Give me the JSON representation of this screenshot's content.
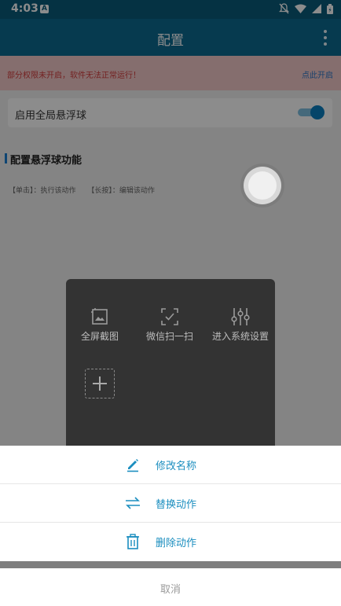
{
  "status": {
    "time": "4:03",
    "app_badge": "A"
  },
  "appbar": {
    "title": "配置"
  },
  "warning": {
    "message": "部分权限未开启，软件无法正常运行！",
    "action": "点此开启"
  },
  "global_toggle": {
    "label": "启用全局悬浮球",
    "enabled": true
  },
  "section": {
    "title": "配置悬浮球功能"
  },
  "hints": {
    "single": "【单击】：执行该动作",
    "long": "【长按】：编辑该动作"
  },
  "panel": {
    "items": [
      {
        "label": "全屏截图",
        "icon": "screenshot-icon"
      },
      {
        "label": "微信扫一扫",
        "icon": "scan-icon"
      },
      {
        "label": "进入系统设置",
        "icon": "settings-sliders-icon"
      }
    ],
    "add_icon": "plus-icon"
  },
  "sheet": {
    "items": [
      {
        "label": "修改名称",
        "icon": "edit-icon"
      },
      {
        "label": "替换动作",
        "icon": "swap-icon"
      },
      {
        "label": "删除动作",
        "icon": "trash-icon"
      }
    ],
    "cancel": "取消"
  },
  "colors": {
    "primary": "#0b6a91",
    "accent": "#1b8ebf",
    "warning_bg": "#f3c9c9",
    "warning_text": "#d23c3c"
  }
}
